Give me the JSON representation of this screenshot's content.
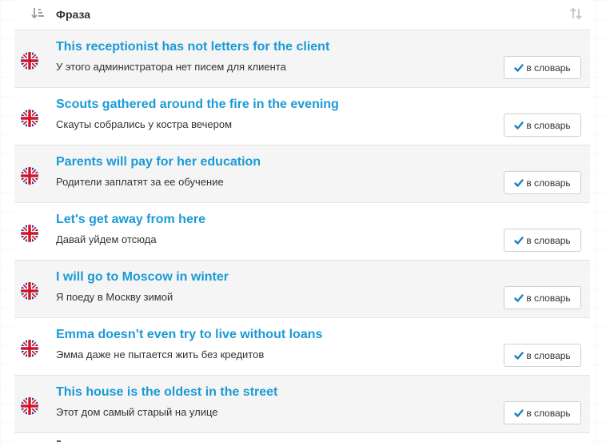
{
  "header": {
    "title": "Фраза",
    "sort_left_icon": "sort-amount-down-icon",
    "sort_right_icon": "sort-arrows-icon"
  },
  "colors": {
    "phrase": "#1a9ad6",
    "check": "#1a7fc1",
    "row_alt": "#f5f5f5"
  },
  "rows": [
    {
      "phrase": "This receptionist has not letters for the client",
      "translation": "У этого администратора нет писем для клиента",
      "flag_icon": "uk-flag-icon",
      "button": "в словарь"
    },
    {
      "phrase": "Scouts gathered around the fire in the evening",
      "translation": "Скауты собрались у костра вечером",
      "flag_icon": "uk-flag-icon",
      "button": "в словарь"
    },
    {
      "phrase": "Parents will pay for her education",
      "translation": "Родители заплатят за ее обучение",
      "flag_icon": "uk-flag-icon",
      "button": "в словарь"
    },
    {
      "phrase": "Let's get away from here",
      "translation": "Давай уйдем отсюда",
      "flag_icon": "uk-flag-icon",
      "button": "в словарь"
    },
    {
      "phrase": "I will go to Moscow in winter",
      "translation": "Я поеду в Москву зимой",
      "flag_icon": "uk-flag-icon",
      "button": "в словарь"
    },
    {
      "phrase": "Emma doesn’t even try to live without loans",
      "translation": "Эмма даже не пытается жить без кредитов",
      "flag_icon": "uk-flag-icon",
      "button": "в словарь"
    },
    {
      "phrase": "This house is the oldest in the street",
      "translation": "Этот дом самый старый на улице",
      "flag_icon": "uk-flag-icon",
      "button": "в словарь"
    }
  ]
}
